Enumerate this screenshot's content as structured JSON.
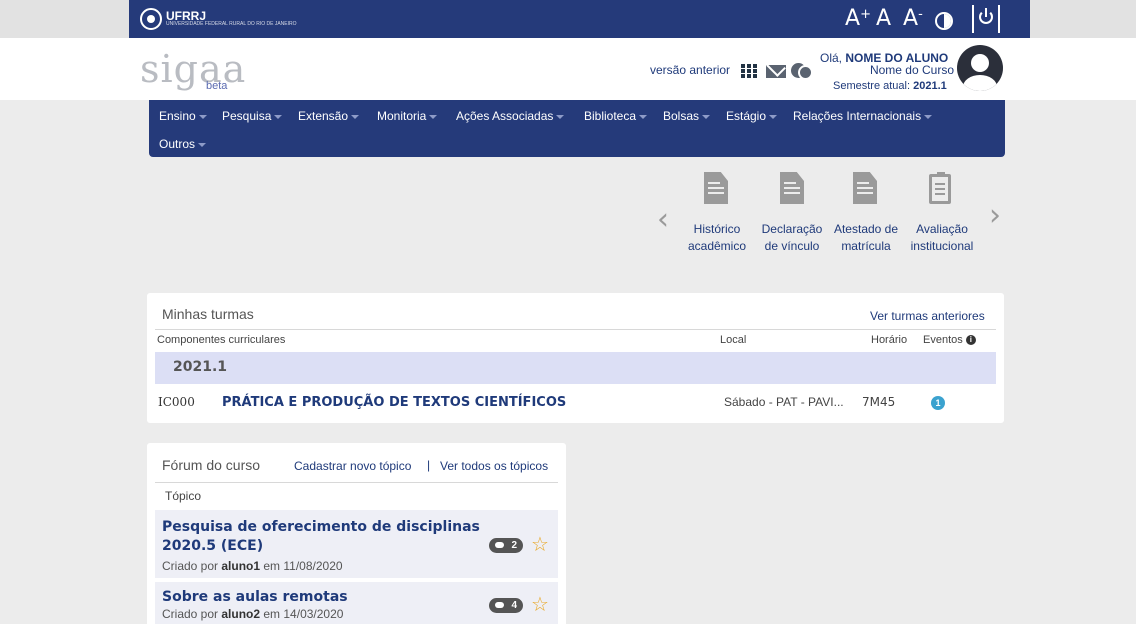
{
  "topbar": {
    "institution": "UFRRJ",
    "institution_sub": "UNIVERSIDADE FEDERAL RURAL DO RIO DE JANEIRO",
    "font_increase": "A+",
    "font_normal": "A",
    "font_decrease": "A-"
  },
  "header": {
    "logo": "sigaa",
    "logo_sub": "beta",
    "previous_version": "versão anterior",
    "greeting_prefix": "Olá, ",
    "student_name": "NOME DO ALUNO",
    "course": "Nome do Curso",
    "semester_label": "Semestre atual: ",
    "semester_value": "2021.1"
  },
  "nav": {
    "items": [
      {
        "label": "Ensino"
      },
      {
        "label": "Pesquisa"
      },
      {
        "label": "Extensão"
      },
      {
        "label": "Monitoria"
      },
      {
        "label": "Ações Associadas"
      },
      {
        "label": "Biblioteca"
      },
      {
        "label": "Bolsas"
      },
      {
        "label": "Estágio"
      },
      {
        "label": "Relações Internacionais"
      },
      {
        "label": "Outros"
      }
    ]
  },
  "shortcuts": [
    {
      "line1": "Histórico",
      "line2": "acadêmico",
      "icon": "document-icon"
    },
    {
      "line1": "Declaração",
      "line2": "de vínculo",
      "icon": "document-icon"
    },
    {
      "line1": "Atestado de",
      "line2": "matrícula",
      "icon": "document-icon"
    },
    {
      "line1": "Avaliação",
      "line2": "institucional",
      "icon": "clipboard-icon"
    }
  ],
  "turmas": {
    "title": "Minhas turmas",
    "previous_link": "Ver turmas anteriores",
    "columns": {
      "component": "Componentes curriculares",
      "local": "Local",
      "schedule": "Horário",
      "events": "Eventos"
    },
    "semester": "2021.1",
    "rows": [
      {
        "code": "IC000",
        "name": "PRÁTICA E PRODUÇÃO DE TEXTOS CIENTÍFICOS",
        "local": "Sábado - PAT - PAVI...",
        "schedule": "7M45",
        "events": "1"
      }
    ]
  },
  "forum": {
    "title": "Fórum do curso",
    "new_topic": "Cadastrar novo tópico",
    "separator": "|",
    "all_topics": "Ver todos os tópicos",
    "column": "Tópico",
    "topics": [
      {
        "title_line1": "Pesquisa de oferecimento de disciplinas",
        "title_line2": "2020.5 (ECE)",
        "created_by": "Criado por ",
        "author": "aluno1",
        "date": " em 11/08/2020",
        "replies": "2"
      },
      {
        "title_line1": "Sobre as aulas remotas",
        "created_by": "Criado por ",
        "author": "aluno2",
        "date": " em 14/03/2020",
        "replies": "4"
      }
    ]
  },
  "colors": {
    "navy": "#253a7a",
    "link": "#1f3a7a",
    "band": "#dcdff5",
    "star": "#e9a92a",
    "badge_blue": "#3ba2cf"
  }
}
